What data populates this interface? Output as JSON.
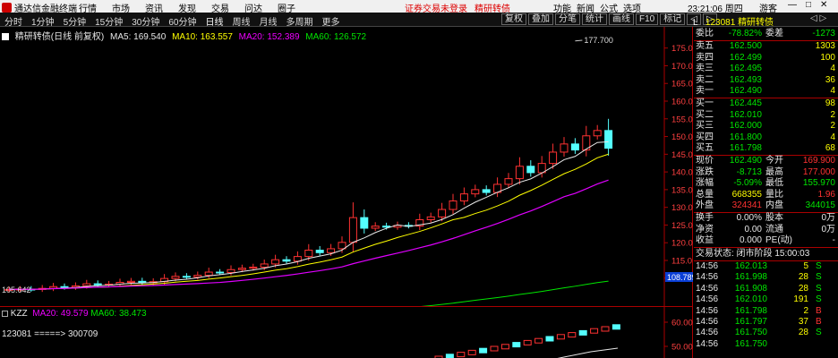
{
  "app": {
    "title": "通达信金融终端",
    "menu": [
      "分时",
      "1分钟",
      "5分钟",
      "15分钟",
      "30分钟",
      "60分钟",
      "日线",
      "周线",
      "月线",
      "多周期",
      "更多"
    ],
    "topmenu": [
      "行情",
      "市场",
      "资讯",
      "发现",
      "交易",
      "问达",
      "圈子"
    ],
    "notice": [
      "证券交易未登录",
      "精研转债"
    ],
    "right": [
      "功能",
      "新闻",
      "公式",
      "选项"
    ],
    "clock": "23:21:06 周四",
    "guest": "游客"
  },
  "toolbar": {
    "tabs": [
      "分时",
      "1分钟",
      "5分钟",
      "15分钟",
      "30分钟",
      "60分钟",
      "日线",
      "周线",
      "月线",
      "多周期",
      "更多"
    ],
    "tools": [
      "复权",
      "叠加",
      "分笔",
      "统计",
      "画线",
      "F10",
      "标记",
      "◁",
      "▷"
    ],
    "code": "123081",
    "name": "精研转债",
    "mark": "L",
    "pager": "◁ ▷"
  },
  "chart": {
    "legend_name": "精研转债(日线 前复权)",
    "ma5": "MA5: 169.540",
    "ma10": "MA10: 163.557",
    "ma20": "MA20: 152.389",
    "ma60": "MA60: 126.572",
    "high_label": "177.700",
    "low_label": "105.642",
    "last_price": "108.789",
    "yaxis": [
      "175.0",
      "170.0",
      "165.0",
      "160.0",
      "155.0",
      "150.0",
      "145.0",
      "140.0",
      "135.0",
      "130.0",
      "125.0",
      "120.0",
      "115.0",
      "110.0"
    ]
  },
  "indicator": {
    "name": "KZZ",
    "ma20": "MA20: 49.579",
    "ma60": "MA60: 38.473",
    "note": "123081 =====> 300709",
    "yaxis": [
      "60.00",
      "50.00"
    ]
  },
  "panel": {
    "weibi": {
      "l": "委比",
      "v": "-78.82%",
      "l2": "委差",
      "v2": "-1273"
    },
    "sells": [
      {
        "l": "卖五",
        "p": "162.500",
        "q": "1303"
      },
      {
        "l": "卖四",
        "p": "162.499",
        "q": "100"
      },
      {
        "l": "卖三",
        "p": "162.495",
        "q": "4"
      },
      {
        "l": "卖二",
        "p": "162.493",
        "q": "36"
      },
      {
        "l": "卖一",
        "p": "162.490",
        "q": "4"
      }
    ],
    "buys": [
      {
        "l": "买一",
        "p": "162.445",
        "q": "98"
      },
      {
        "l": "买二",
        "p": "162.010",
        "q": "2"
      },
      {
        "l": "买三",
        "p": "162.000",
        "q": "2"
      },
      {
        "l": "买四",
        "p": "161.800",
        "q": "4"
      },
      {
        "l": "买五",
        "p": "161.798",
        "q": "68"
      }
    ],
    "stats": [
      {
        "l": "现价",
        "v": "162.490",
        "l2": "今开",
        "v2": "169.900"
      },
      {
        "l": "涨跌",
        "v": "-8.713",
        "l2": "最高",
        "v2": "177.000"
      },
      {
        "l": "涨幅",
        "v": "-5.09%",
        "l2": "最低",
        "v2": "155.970"
      },
      {
        "l": "总量",
        "v": "668355",
        "l2": "量比",
        "v2": "1.96"
      },
      {
        "l": "外盘",
        "v": "324341",
        "l2": "内盘",
        "v2": "344015"
      }
    ],
    "stats2": [
      {
        "l": "换手",
        "v": "0.00%",
        "l2": "股本",
        "v2": "0万"
      },
      {
        "l": "净资",
        "v": "0.00",
        "l2": "流通",
        "v2": "0万"
      },
      {
        "l": "收益",
        "v": "0.000",
        "l2": "PE(动)",
        "v2": "-"
      }
    ],
    "state": "交易状态: 闭市阶段 15:00:03",
    "ticks": [
      {
        "t": "14:56",
        "p": "162.013",
        "q": "5",
        "s": "S"
      },
      {
        "t": "14:56",
        "p": "161.998",
        "q": "28",
        "s": "S"
      },
      {
        "t": "14:56",
        "p": "161.908",
        "q": "28",
        "s": "S"
      },
      {
        "t": "14:56",
        "p": "162.010",
        "q": "191",
        "s": "S"
      },
      {
        "t": "14:56",
        "p": "161.798",
        "q": "2",
        "s": "B"
      },
      {
        "t": "14:56",
        "p": "161.797",
        "q": "37",
        "s": "B"
      },
      {
        "t": "14:56",
        "p": "161.750",
        "q": "28",
        "s": "S"
      },
      {
        "t": "14:56",
        "p": "161.750",
        "q": "",
        "s": ""
      }
    ]
  }
}
